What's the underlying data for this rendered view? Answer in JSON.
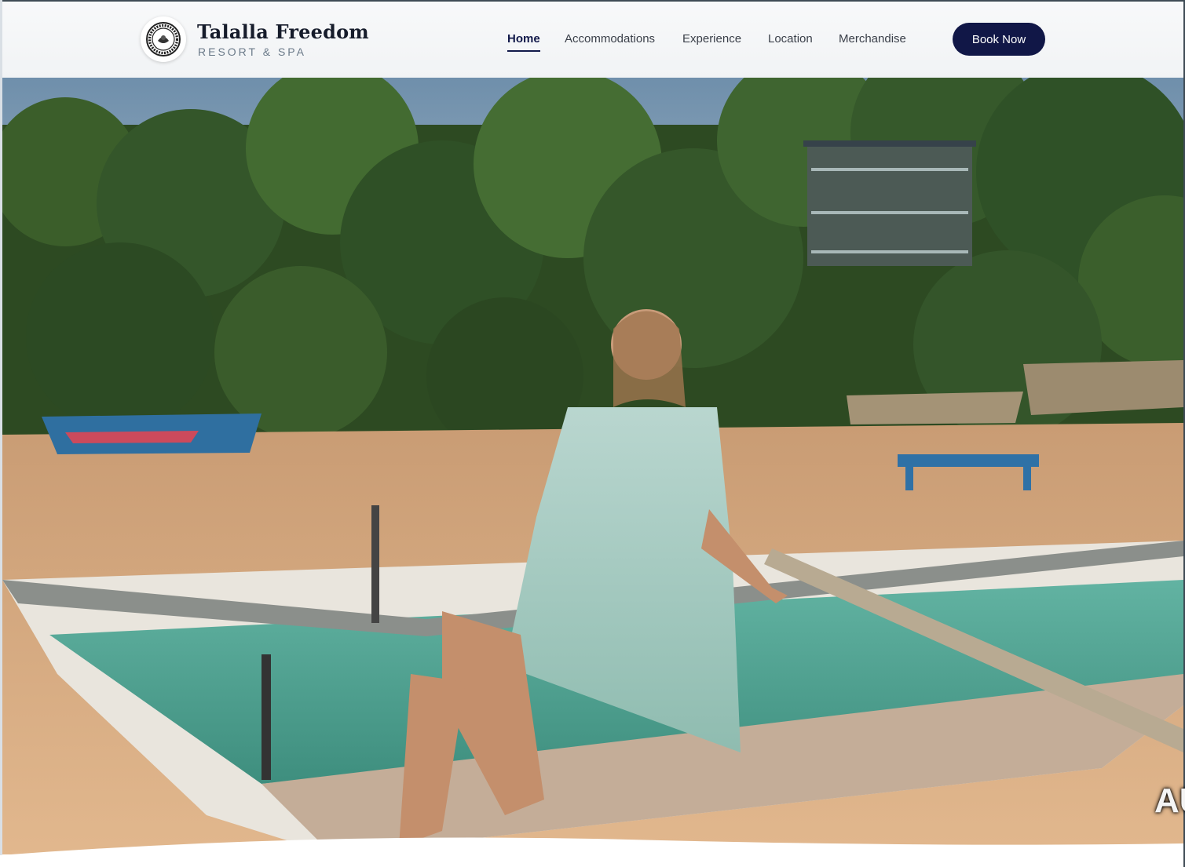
{
  "brand": {
    "name": "Talalla Freedom",
    "subtitle": "RESORT & SPA",
    "logo_icon": "resort-seal-logo",
    "logo_ring_text": "FREEDOM RESORT TALALLA"
  },
  "nav": {
    "items": [
      {
        "label": "Home",
        "active": true
      },
      {
        "label": "Accommodations",
        "active": false
      },
      {
        "label": "Experience",
        "active": false
      },
      {
        "label": "Location",
        "active": false
      },
      {
        "label": "Merchandise",
        "active": false
      }
    ],
    "cta_label": "Book Now"
  },
  "hero": {
    "media": "beach-video-frame",
    "overlay_text": "AU"
  },
  "colors": {
    "primary": "#111747",
    "nav_text": "#3a3f49",
    "subtitle": "#6b7a89",
    "header_bg": "#f5f6f8"
  }
}
